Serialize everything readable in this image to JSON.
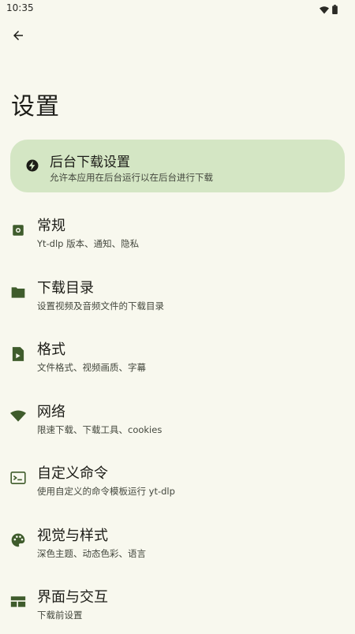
{
  "status_bar": {
    "time": "10:35",
    "icons": [
      "wifi-icon",
      "battery-icon"
    ]
  },
  "header": {
    "back_icon": "arrow-left-icon",
    "title": "设置"
  },
  "banner": {
    "icon": "bolt-icon",
    "title": "后台下载设置",
    "description": "允许本应用在后台运行以在后台进行下载",
    "color": "#d4e6c4"
  },
  "settings": [
    {
      "icon": "settings-gear-icon",
      "title": "常规",
      "description": "Yt-dlp 版本、通知、隐私"
    },
    {
      "icon": "folder-icon",
      "title": "下载目录",
      "description": "设置视频及音频文件的下载目录"
    },
    {
      "icon": "file-video-icon",
      "title": "格式",
      "description": "文件格式、视频画质、字幕"
    },
    {
      "icon": "wifi-icon",
      "title": "网络",
      "description": "限速下载、下载工具、cookies"
    },
    {
      "icon": "terminal-icon",
      "title": "自定义命令",
      "description": "使用自定义的命令模板运行 yt-dlp"
    },
    {
      "icon": "palette-icon",
      "title": "视觉与样式",
      "description": "深色主题、动态色彩、语言"
    },
    {
      "icon": "layout-icon",
      "title": "界面与交互",
      "description": "下载前设置"
    }
  ],
  "colors": {
    "background": "#f8f8ee",
    "icon_accent": "#3f5c2c",
    "text": "#1c1c17",
    "subtext": "#44483e"
  }
}
